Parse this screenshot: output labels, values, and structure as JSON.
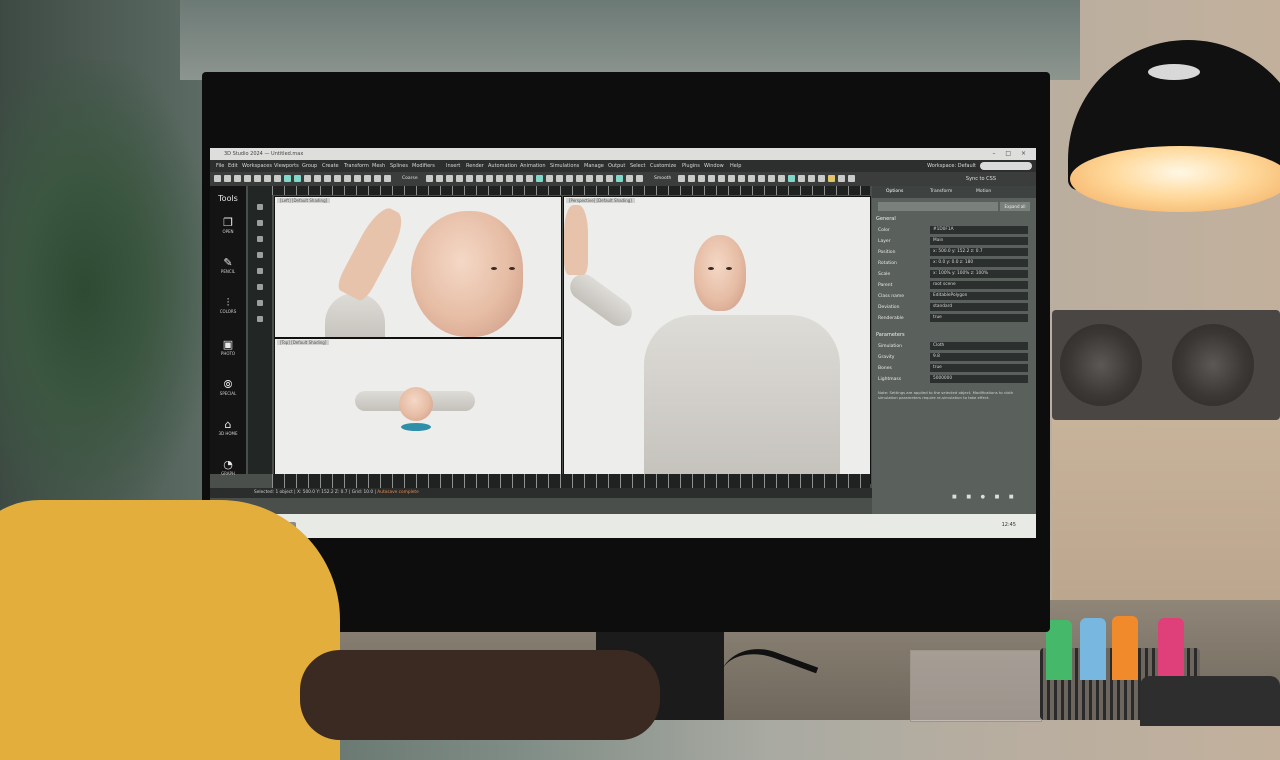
{
  "app": {
    "title": "3D Studio 2024 — Untitled.max",
    "window_controls": "– □ ×",
    "workspace": "Workspace: Default"
  },
  "menu": [
    "File",
    "Edit",
    "Workspaces",
    "Viewports",
    "Group",
    "Create",
    "Transform",
    "Mesh",
    "Splines",
    "Modifiers",
    "Insert",
    "Render",
    "Automation",
    "Animation",
    "Simulations",
    "Manage",
    "Output",
    "Select",
    "Customize",
    "Plugins",
    "Window",
    "Help"
  ],
  "toolbar": {
    "label_a": "Coarse",
    "label_b": "Smooth",
    "sync": "Sync to CSS"
  },
  "tools": {
    "title": "Tools",
    "items": [
      {
        "icon": "❐",
        "label": "OPEN"
      },
      {
        "icon": "✎",
        "label": "PENCIL"
      },
      {
        "icon": "⫶",
        "label": "COLORS"
      },
      {
        "icon": "▣",
        "label": "PHOTO"
      },
      {
        "icon": "⦾",
        "label": "SPECIAL"
      },
      {
        "icon": "⌂",
        "label": "3D HOME"
      },
      {
        "icon": "◔",
        "label": "GRAPH"
      }
    ]
  },
  "viewports": {
    "top_left": "[Left] [Default Shading]",
    "bottom_left": "[Top] [Default Shading]",
    "right": "[Perspective] [Default Shading]"
  },
  "panel": {
    "tabs": [
      "Options",
      "Transform",
      "Motion"
    ],
    "expand": "Expand all",
    "general_title": "General",
    "general": [
      {
        "k": "Color",
        "v": "#1D0F1A"
      },
      {
        "k": "Layer",
        "v": "Main"
      },
      {
        "k": "Position",
        "v": "x: 500.0   y: 152.2   z: 0.7"
      },
      {
        "k": "Rotation",
        "v": "x: 0.0   y: 0.0   z: 180"
      },
      {
        "k": "Scale",
        "v": "x: 100%   y: 100%   z: 100%"
      },
      {
        "k": "Parent",
        "v": "root scene"
      },
      {
        "k": "Class name",
        "v": "EditablePolygon"
      },
      {
        "k": "Deviation",
        "v": "standard"
      },
      {
        "k": "Renderable",
        "v": "true"
      }
    ],
    "params_title": "Parameters",
    "params": [
      {
        "k": "Simulation",
        "v": "Cloth"
      },
      {
        "k": "Gravity",
        "v": "9.8"
      },
      {
        "k": "Bones",
        "v": "true"
      },
      {
        "k": "Lightmass",
        "v": "5000000"
      }
    ],
    "note": "Note: Settings are applied to the selected object. Modifications to cloth simulation parameters require re-simulation to take effect.",
    "buttons": "■ ■ ● ■ ■"
  },
  "status": {
    "text": "Selected: 1 object  |  X: 500.0  Y: 152.2  Z: 0.7  |  Grid: 10.0  |",
    "ok": "Autosave complete"
  },
  "taskbar": {
    "time": "12:45"
  }
}
